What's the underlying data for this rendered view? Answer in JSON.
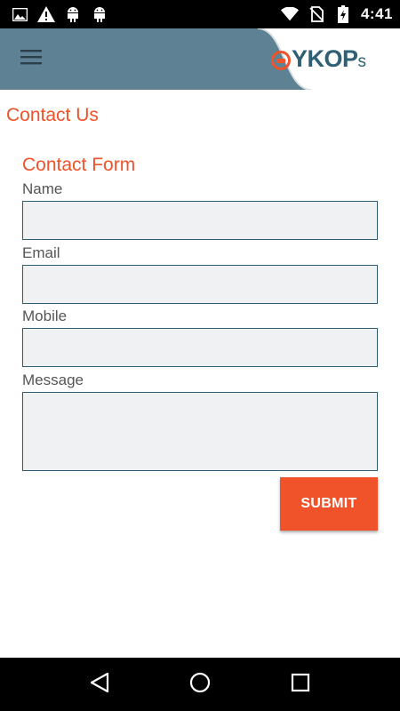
{
  "status_bar": {
    "time": "4:41",
    "left_icons": [
      "image-icon",
      "warning-icon",
      "android-icon",
      "android-icon"
    ],
    "right_icons": [
      "wifi-icon",
      "no-sim-icon",
      "battery-charging-icon"
    ]
  },
  "app_bar": {
    "logo_text": "YKOP",
    "logo_suffix": "s",
    "background_color": "#5e8193"
  },
  "page": {
    "title": "Contact Us"
  },
  "form": {
    "title": "Contact Form",
    "fields": {
      "name": {
        "label": "Name",
        "value": ""
      },
      "email": {
        "label": "Email",
        "value": ""
      },
      "mobile": {
        "label": "Mobile",
        "value": ""
      },
      "message": {
        "label": "Message",
        "value": ""
      }
    },
    "submit_label": "SUBMIT"
  },
  "colors": {
    "accent": "#f0522a",
    "input_border": "#2f5d73",
    "input_bg": "#eff1f2"
  },
  "nav_bar": {
    "icons": [
      "back-icon",
      "home-icon",
      "recents-icon"
    ]
  }
}
